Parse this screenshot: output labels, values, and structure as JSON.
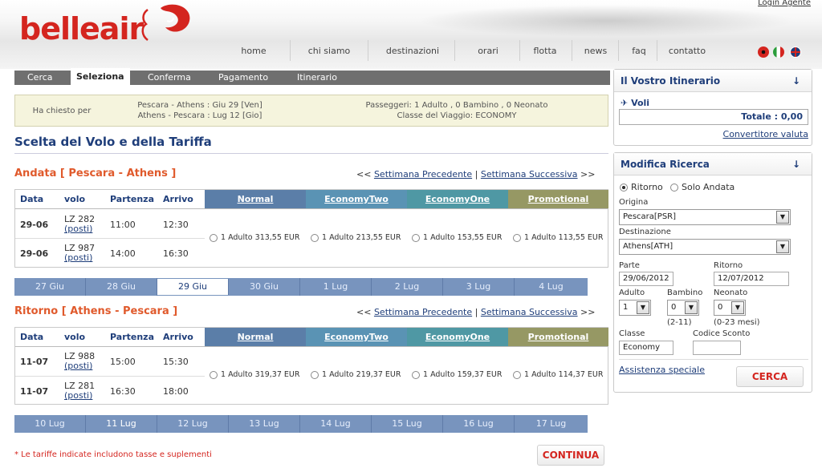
{
  "header": {
    "logo_text": "belleair",
    "login_link": "Login Agente",
    "nav": [
      "home",
      "chi siamo",
      "destinazioni",
      "orari",
      "flotta",
      "news",
      "faq",
      "contatto"
    ],
    "flags": [
      "albania",
      "italy",
      "uk"
    ]
  },
  "steps": [
    "Cerca",
    "Seleziona",
    "Conferma",
    "Pagamento",
    "Itinerario"
  ],
  "request": {
    "label": "Ha chiesto per",
    "route1": "Pescara - Athens : Giu 29 [Ven]",
    "route2": "Athens - Pescara : Lug 12 [Gio]",
    "passengers": "Passeggeri:  1  Adulto , 0  Bambino , 0  Neonato",
    "class": "Classe del Viaggio: ECONOMY"
  },
  "page_title": "Scelta del Volo e della Tariffa",
  "week_nav": {
    "prev": "Settimana Precedente",
    "next": "Settimana Successiva",
    "left_arrows": "<<",
    "right_arrows": ">>",
    "sep": "|"
  },
  "columns": {
    "data": "Data",
    "volo": "volo",
    "partenza": "Partenza",
    "arrivo": "Arrivo"
  },
  "fares": [
    {
      "name": "Normal",
      "color": "#5b7ea8"
    },
    {
      "name": "EconomyTwo",
      "color": "#5a93b4"
    },
    {
      "name": "EconomyOne",
      "color": "#4f98a4"
    },
    {
      "name": "Promotional",
      "color": "#969864"
    }
  ],
  "outbound": {
    "title": "Andata [ Pescara - Athens ]",
    "flights": [
      {
        "date": "29-06",
        "flight": "LZ 282",
        "posti": "(posti)",
        "dep": "11:00",
        "arr": "12:30"
      },
      {
        "date": "29-06",
        "flight": "LZ 987",
        "posti": "(posti)",
        "dep": "14:00",
        "arr": "16:30"
      }
    ],
    "prices": [
      "1 Adulto 313,55 EUR",
      "1 Adulto 213,55 EUR",
      "1 Adulto 153,55 EUR",
      "1 Adulto 113,55 EUR"
    ],
    "dates": [
      "27 Giu",
      "28 Giu",
      "29 Giu",
      "30 Giu",
      "1 Lug",
      "2 Lug",
      "3 Lug",
      "4 Lug"
    ],
    "selected_date": "29 Giu"
  },
  "inbound": {
    "title": "Ritorno [ Athens - Pescara ]",
    "flights": [
      {
        "date": "11-07",
        "flight": "LZ 988",
        "posti": "(posti)",
        "dep": "15:00",
        "arr": "15:30"
      },
      {
        "date": "11-07",
        "flight": "LZ 281",
        "posti": "(posti)",
        "dep": "16:30",
        "arr": "18:00"
      }
    ],
    "prices": [
      "1 Adulto 319,37 EUR",
      "1 Adulto 219,37 EUR",
      "1 Adulto 159,37 EUR",
      "1 Adulto 114,37 EUR"
    ],
    "dates": [
      "10 Lug",
      "11 Lug",
      "12 Lug",
      "13 Lug",
      "14 Lug",
      "15 Lug",
      "16 Lug",
      "17 Lug"
    ],
    "selected_date": "11 Lug"
  },
  "note": "* Le tariffe indicate includono tasse e suplementi",
  "continue_label": "CONTINUA",
  "itinerary": {
    "title": "Il Vostro Itinerario",
    "voli": "Voli",
    "totale": "Totale : 0,00",
    "converter": "Convertitore valuta"
  },
  "search": {
    "title": "Modifica Ricerca",
    "ritorno": "Ritorno",
    "solo_andata": "Solo Andata",
    "origine_label": "Origina",
    "origine": "Pescara[PSR]",
    "dest_label": "Destinazione",
    "dest": "Athens[ATH]",
    "parte_label": "Parte",
    "parte": "29/06/2012",
    "ritorno_label": "Ritorno",
    "ritorno_date": "12/07/2012",
    "adulto_label": "Adulto",
    "bambino_label": "Bambino",
    "neonato_label": "Neonato",
    "adulto": "1",
    "bambino": "0",
    "neonato": "0",
    "bambino_hint": "(2-11)",
    "neonato_hint": "(0-23 mesi)",
    "classe_label": "Classe",
    "classe": "Economy",
    "codice_label": "Codice Sconto",
    "codice": "",
    "assistenza": "Assistenza speciale",
    "cerca": "CERCA"
  }
}
